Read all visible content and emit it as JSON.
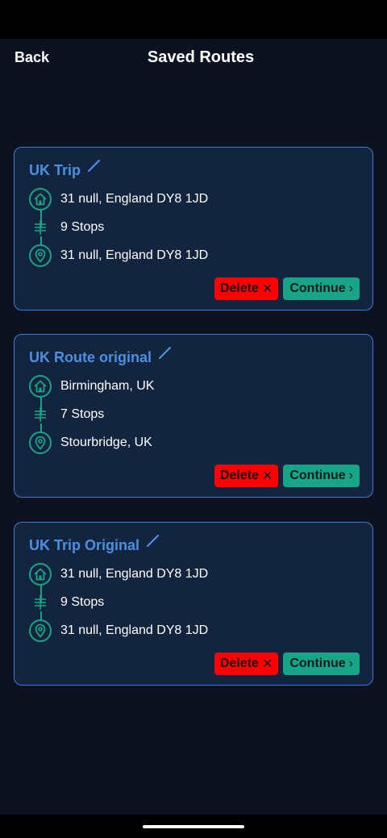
{
  "header": {
    "back_label": "Back",
    "title": "Saved Routes"
  },
  "routes": [
    {
      "name": "UK Trip",
      "start": "31 null, England DY8 1JD",
      "stops": "9 Stops",
      "end": "31 null, England DY8 1JD",
      "delete_label": "Delete",
      "continue_label": "Continue"
    },
    {
      "name": "UK Route original",
      "start": "Birmingham, UK",
      "stops": "7 Stops",
      "end": "Stourbridge, UK",
      "delete_label": "Delete",
      "continue_label": "Continue"
    },
    {
      "name": "UK Trip Original",
      "start": "31 null, England DY8 1JD",
      "stops": "9 Stops",
      "end": "31 null, England DY8 1JD",
      "delete_label": "Delete",
      "continue_label": "Continue"
    }
  ],
  "icons": {
    "start": "home-icon",
    "stops": "stops-icon",
    "end": "location-pin-icon",
    "edit": "pencil-icon",
    "delete": "close-icon",
    "continue": "chevron-right-icon"
  },
  "colors": {
    "background": "#0c1220",
    "card": "#13243f",
    "card_border": "#3a7bd5",
    "route_name": "#4a90e2",
    "accent_teal": "#17a487",
    "delete_red": "#ff0000"
  }
}
